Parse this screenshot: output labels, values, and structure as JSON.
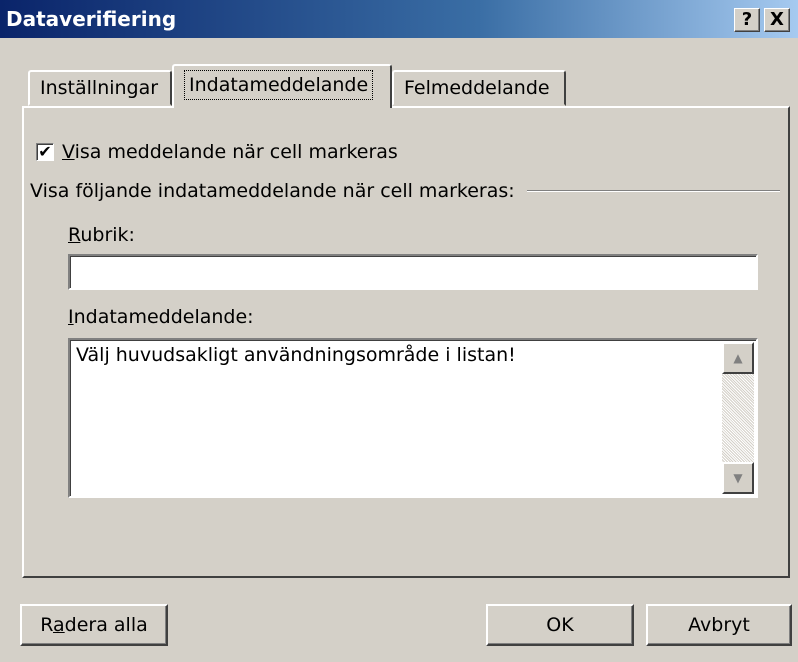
{
  "window": {
    "title": "Dataverifiering",
    "help_label": "?",
    "close_label": "X"
  },
  "tabs": [
    {
      "label": "Inställningar"
    },
    {
      "label": "Indatameddelande"
    },
    {
      "label": "Felmeddelande"
    }
  ],
  "checkbox": {
    "label_prefix": "V",
    "label_rest": "isa meddelande när cell markeras",
    "checked": true
  },
  "group": {
    "label": "Visa följande indatameddelande när cell markeras:"
  },
  "rubrik": {
    "label_prefix": "R",
    "label_rest": "ubrik:",
    "value": ""
  },
  "indata": {
    "label_prefix": "I",
    "label_rest": "ndatameddelande:",
    "value": "Välj huvudsakligt användningsområde i listan!"
  },
  "buttons": {
    "clear_prefix": "R",
    "clear_underlined": "a",
    "clear_rest": "dera alla",
    "ok": "OK",
    "cancel": "Avbryt"
  }
}
